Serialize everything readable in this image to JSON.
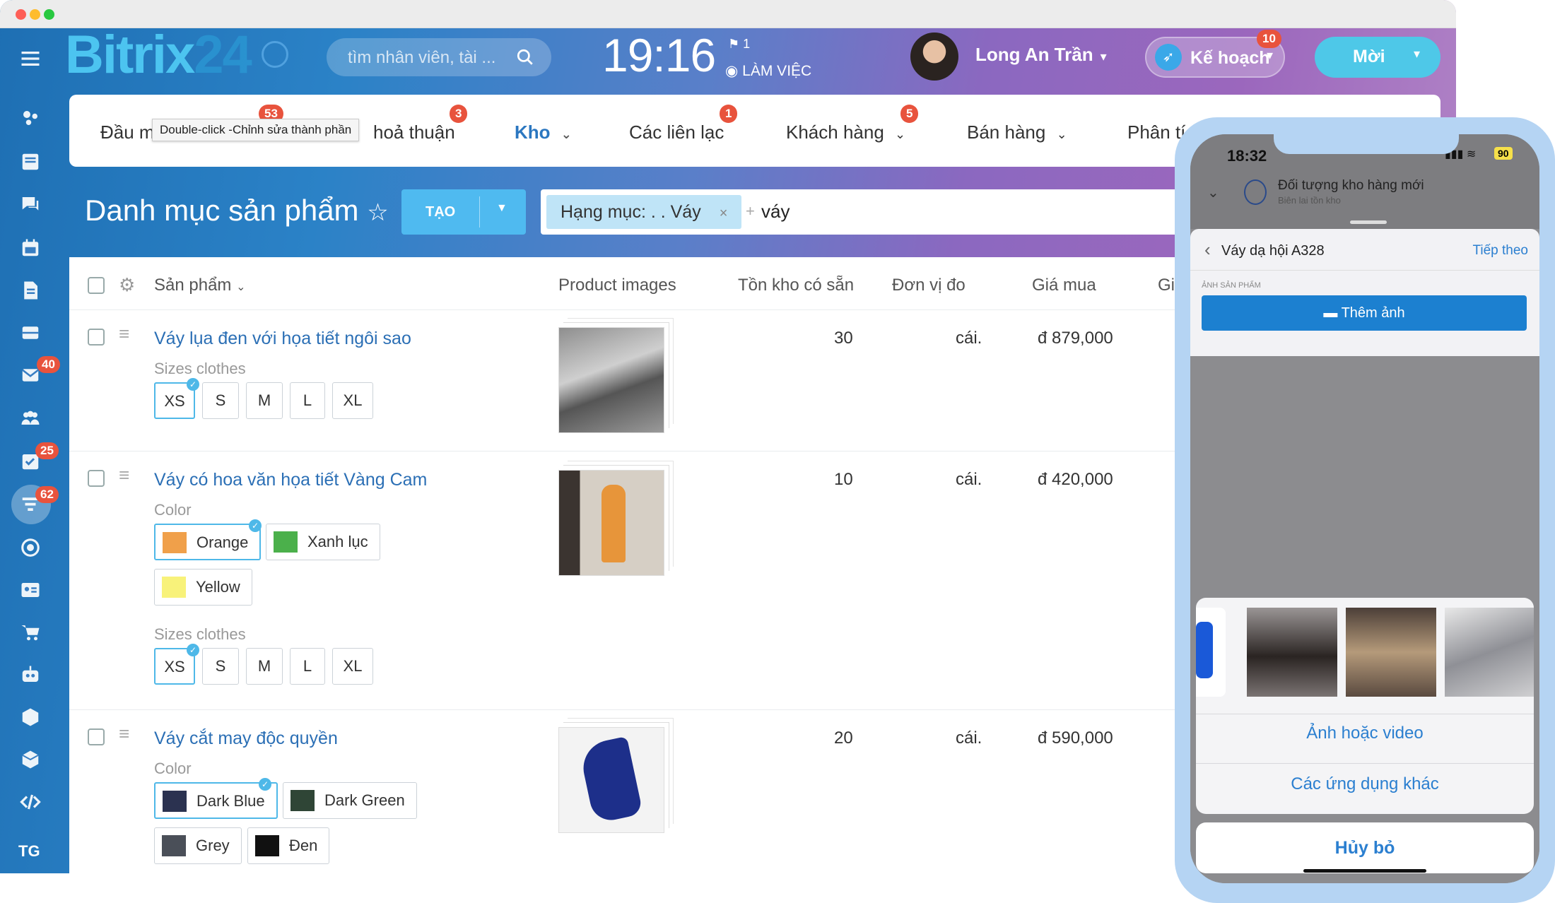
{
  "window": {
    "title": "Bitrix24"
  },
  "header": {
    "logo_text": "Bitrix",
    "logo_suffix": "24",
    "search_placeholder": "tìm nhân viên, tài ...",
    "time": "19:16",
    "flag_count": "1",
    "status": "LÀM VIỆC",
    "user_name": "Long An Trần",
    "plan_label": "Kế hoạch",
    "plan_badge": "10",
    "new_label": "Mời"
  },
  "sidebar": {
    "badges": {
      "mail": "40",
      "tasks": "25",
      "crm": "62"
    },
    "bottom_label": "TG"
  },
  "tabs": [
    {
      "label": "Đầu m",
      "badge": "53"
    },
    {
      "label": "hoả thuận",
      "badge": "3"
    },
    {
      "label": "Kho",
      "badge": ""
    },
    {
      "label": "Các liên lạc",
      "badge": "1"
    },
    {
      "label": "Khách hàng",
      "badge": "5"
    },
    {
      "label": "Bán hàng",
      "badge": ""
    },
    {
      "label": "Phân tí",
      "badge": ""
    }
  ],
  "tooltip": "Double-click -Chỉnh sửa thành phần",
  "page": {
    "title": "Danh mục sản phẩm",
    "create_label": "TẠO",
    "filter_chip": "Hạng mục: . . Váy",
    "filter_text": "váy"
  },
  "table": {
    "headers": [
      "Sản phẩm",
      "Product images",
      "Tồn kho có sẵn",
      "Đơn vị đo",
      "Giá mua",
      "Gi"
    ],
    "rows": [
      {
        "name": "Váy lụa đen với họa tiết ngôi sao",
        "qty": "30",
        "unit": "cái.",
        "price": "đ 879,000",
        "groups": [
          {
            "label": "Sizes clothes",
            "options": [
              "XS",
              "S",
              "M",
              "L",
              "XL"
            ],
            "selected": "XS"
          }
        ]
      },
      {
        "name": "Váy có hoa văn họa tiết Vàng Cam",
        "qty": "10",
        "unit": "cái.",
        "price": "đ 420,000",
        "groups": [
          {
            "label": "Color",
            "options": [
              "Orange",
              "Xanh lục",
              "Yellow"
            ],
            "selected": "Orange"
          },
          {
            "label": "Sizes clothes",
            "options": [
              "XS",
              "S",
              "M",
              "L",
              "XL"
            ],
            "selected": "XS"
          }
        ]
      },
      {
        "name": "Váy cắt may độc quyền",
        "qty": "20",
        "unit": "cái.",
        "price": "đ 590,000",
        "groups": [
          {
            "label": "Color",
            "options": [
              "Dark Blue",
              "Dark Green",
              "Grey",
              "Đen"
            ],
            "selected": "Dark Blue"
          }
        ]
      }
    ],
    "colors": {
      "Orange": "#f0a04a",
      "Xanh lục": "#4bb04b",
      "Yellow": "#f8f27a",
      "Dark Blue": "#2b3250",
      "Dark Green": "#2f4536",
      "Grey": "#4a4f58",
      "Đen": "#111111"
    }
  },
  "phone": {
    "time": "18:32",
    "battery": "90",
    "bg_title": "Đối tượng kho hàng mới",
    "bg_subtitle": "Biên lai tồn kho",
    "nav_back_title": "Váy dạ hội A328",
    "nav_next": "Tiếp theo",
    "section_label": "ẢNH SẢN PHẨM",
    "add_photo": "Thêm ảnh",
    "action_media": "Ảnh hoặc video",
    "action_other_apps": "Các ứng dụng khác",
    "cancel": "Hủy bỏ"
  }
}
